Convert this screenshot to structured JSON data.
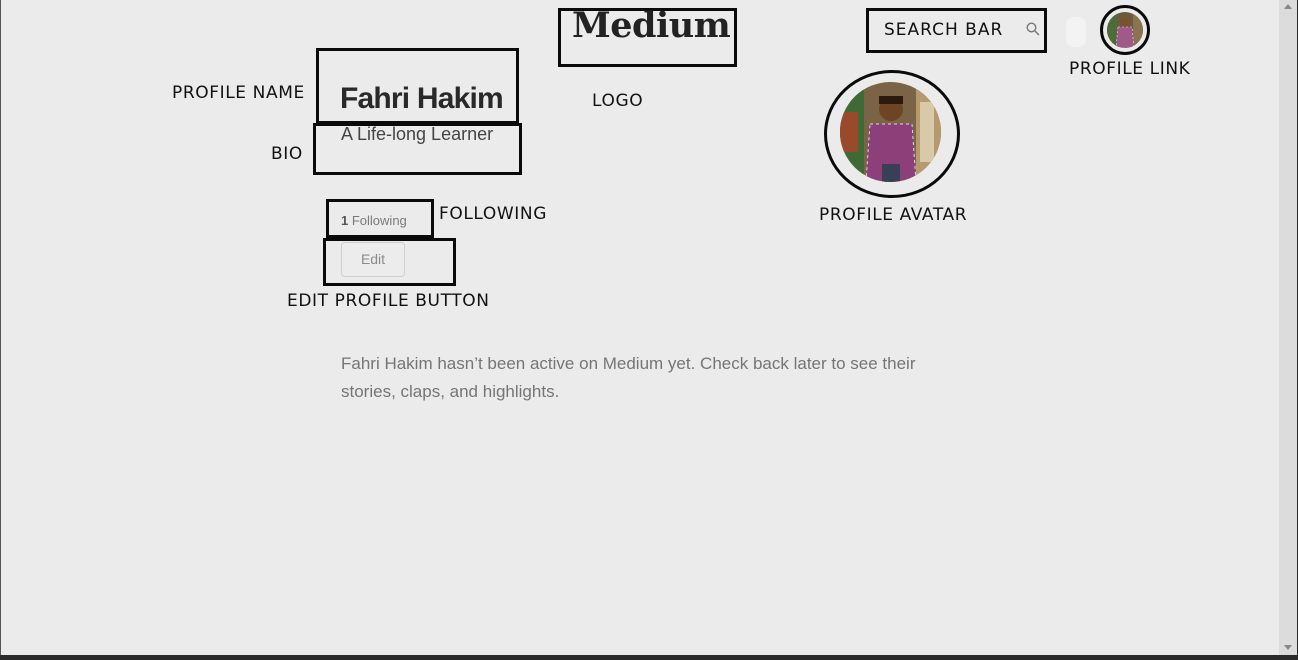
{
  "header": {
    "logo_text": "Medium",
    "search_label": "SEARCH BAR"
  },
  "profile": {
    "name": "Fahri Hakim",
    "bio": "A Life-long Learner",
    "following_count": "1",
    "following_label": "Following",
    "edit_label": "Edit",
    "inactive_message": "Fahri Hakim hasn’t been active on Medium yet. Check back later to see their stories, claps, and highlights."
  },
  "annotations": {
    "logo": "LOGO",
    "profile_name": "PROFILE NAME",
    "bio": "BIO",
    "following": "FOLLOWING",
    "edit_profile_button": "EDIT PROFILE BUTTON",
    "profile_avatar": "PROFILE AVATAR",
    "profile_link": "PROFILE LINK"
  },
  "icons": {
    "search": "search-icon",
    "avatar": "avatar",
    "profile_link": "profile-link-avatar"
  },
  "colors": {
    "background": "#ebebeb",
    "text_dark": "#292929",
    "text_muted": "#757575",
    "annotation_border": "#0a0a0a"
  }
}
